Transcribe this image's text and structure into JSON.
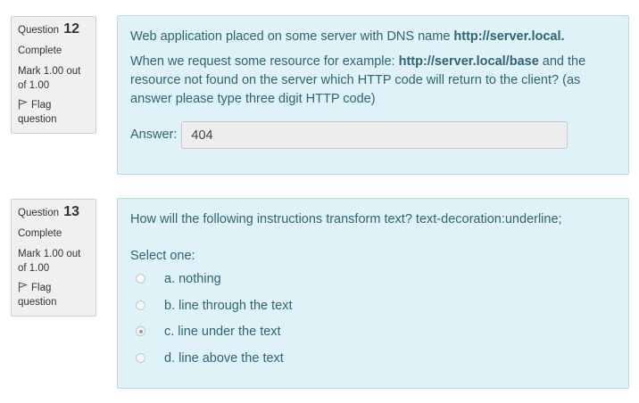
{
  "questions": [
    {
      "label": "Question",
      "number": "12",
      "state": "Complete",
      "mark": "Mark 1.00 out of 1.00",
      "flag_label": "Flag question",
      "text_pre": "Web application placed on some server with DNS name ",
      "text_url": "http://server.local.",
      "p2_pre": "When we request some resource for example: ",
      "p2_url": "http://server.local/base",
      "p2_post": " and the resource not found on the server which HTTP code will return to the client? (as answer please type three digit HTTP code)",
      "answer_label": "Answer:",
      "answer_value": "404"
    },
    {
      "label": "Question",
      "number": "13",
      "state": "Complete",
      "mark": "Mark 1.00 out of 1.00",
      "flag_label": "Flag question",
      "text": "How will the following instructions transform text? text-decoration:underline;",
      "select_label": "Select one:",
      "options": [
        {
          "label": "a. nothing",
          "selected": false
        },
        {
          "label": "b. line through the text",
          "selected": false
        },
        {
          "label": "c. line under the text",
          "selected": true
        },
        {
          "label": "d. line above the text",
          "selected": false
        }
      ]
    }
  ],
  "colors": {
    "info_bg": "#f0f0f0",
    "content_bg": "#def2f8",
    "content_text": "#2f6473"
  }
}
